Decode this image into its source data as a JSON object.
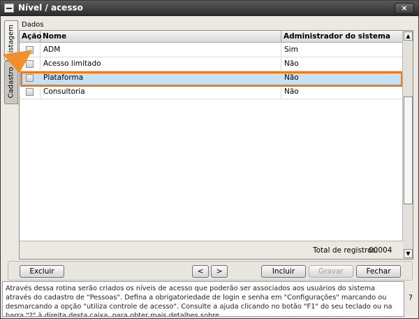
{
  "window": {
    "title": "Nível / acesso",
    "close_label": "×"
  },
  "sidetabs": {
    "listagem": "Listagem",
    "cadastro": "Cadastro"
  },
  "section_label": "Dados",
  "grid": {
    "columns": [
      "Ação",
      "Nome",
      "Administrador do sistema"
    ],
    "rows": [
      {
        "nome": "ADM",
        "admin": "Sim"
      },
      {
        "nome": "Acesso limitado",
        "admin": "Não"
      },
      {
        "nome": "Plataforma",
        "admin": "Não"
      },
      {
        "nome": "Consultoria",
        "admin": "Não"
      }
    ],
    "selected_row": 2,
    "total_label": "Total de registros:",
    "total_value": "00004"
  },
  "buttons": {
    "excluir": "Excluir",
    "prev": "<",
    "next": ">",
    "incluir": "Incluir",
    "gravar": "Gravar",
    "fechar": "Fechar"
  },
  "help": {
    "text": "Através dessa rotina serão criados os níveis de acesso que poderão ser associados aos usuários do sistema através do cadastro de \"Pessoas\". Defina a obrigatoriedade de login e senha em \"Configurações\" marcando ou desmarcando a opção \"utiliza controle de acesso\". Consulte a ajuda clicando no botão \"F1\" do seu teclado ou na barra \"?\" à direita desta caixa, para obter mais detalhes sobre",
    "question": "?"
  },
  "colors": {
    "highlight": "#f07a18",
    "selected_row": "#c7e0f4",
    "titlebar": "#2c2c2c"
  }
}
